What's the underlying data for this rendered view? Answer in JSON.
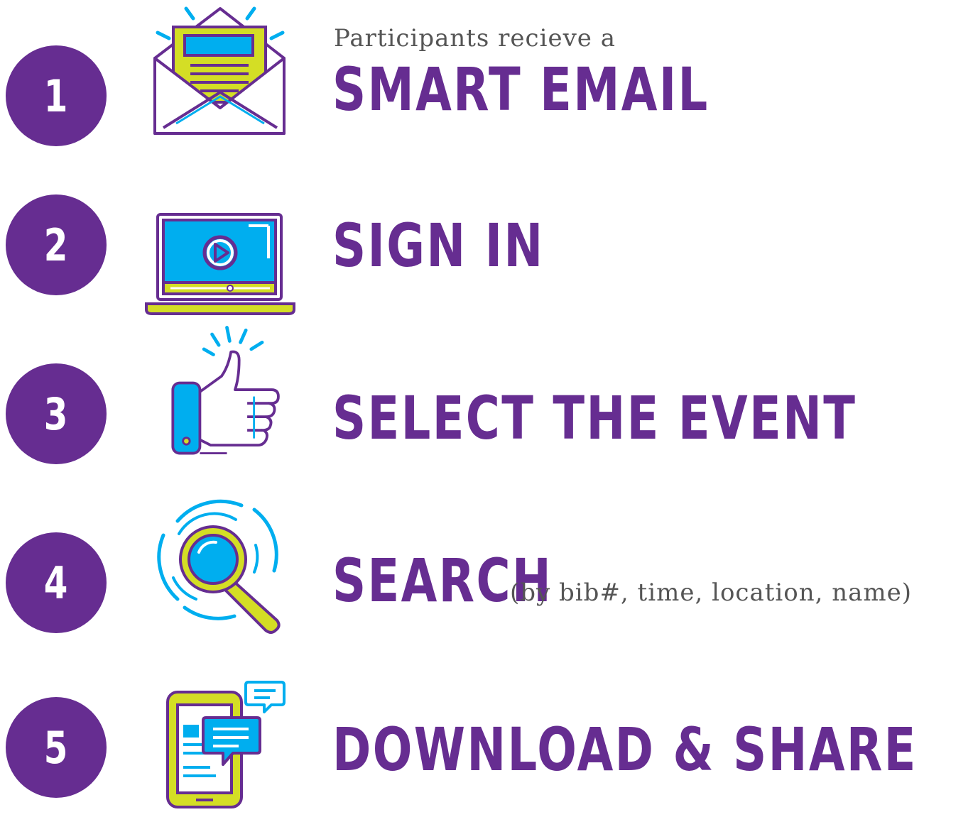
{
  "colors": {
    "purple": "#662d91",
    "lime": "#d4de25",
    "blue": "#00aeef",
    "text_gray": "#555555"
  },
  "steps": [
    {
      "number": "1",
      "icon": "email-icon",
      "pre_text": "Participants recieve a",
      "title": "SMART EMAIL"
    },
    {
      "number": "2",
      "icon": "laptop-video-icon",
      "title": "SIGN IN"
    },
    {
      "number": "3",
      "icon": "thumbs-up-icon",
      "title": "SELECT THE EVENT"
    },
    {
      "number": "4",
      "icon": "magnifier-icon",
      "title": "SEARCH",
      "post_text": "(by bib#, time, location, name)"
    },
    {
      "number": "5",
      "icon": "phone-chat-icon",
      "title": "DOWNLOAD & SHARE"
    }
  ]
}
